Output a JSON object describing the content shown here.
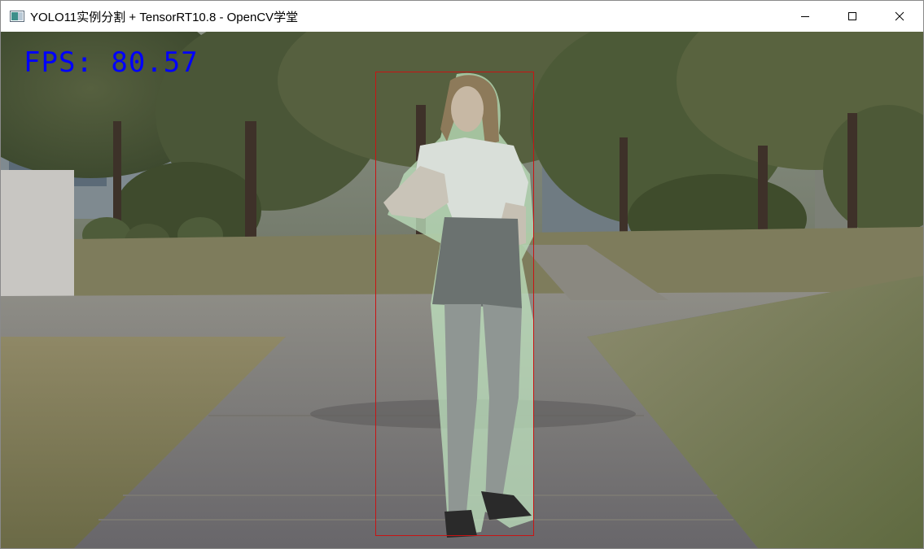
{
  "window": {
    "title": "YOLO11实例分割 + TensorRT10.8 - OpenCV学堂",
    "icons": {
      "app": "opencv-window-icon",
      "minimize": "minimize-icon",
      "maximize": "maximize-icon",
      "close": "close-icon"
    }
  },
  "overlay": {
    "fps_text": "FPS: 80.57",
    "fps_color": "#0000ff",
    "bbox_color": "#c81414",
    "mask_color": "#c8ebc8"
  }
}
